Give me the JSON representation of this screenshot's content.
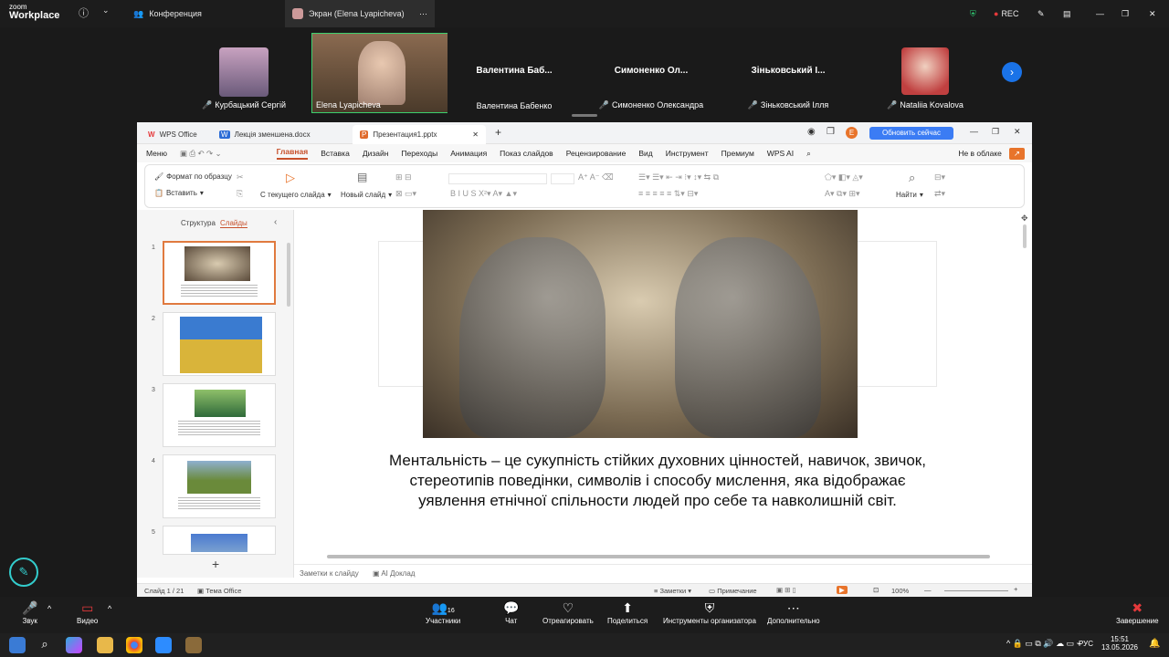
{
  "zoom": {
    "logo_small": "zoom",
    "logo_big": "Workplace",
    "tab_conference": "Конференция",
    "tab_screen": "Экран (Elena Lyapicheva)",
    "rec": "REC"
  },
  "participants": [
    {
      "name": "Курбацький Сергій",
      "big": ""
    },
    {
      "name": "Elena Lyapicheva",
      "big": ""
    },
    {
      "name": "Валентина Бабенко",
      "big": "Валентина  Баб..."
    },
    {
      "name": "Симоненко Олександра",
      "big": "Симоненко  Ол..."
    },
    {
      "name": "Зіньковський Ілля",
      "big": "Зіньковський І..."
    },
    {
      "name": "Nataliia Kovalova",
      "big": ""
    }
  ],
  "wps": {
    "tabs": [
      "WPS Office",
      "Лекція зменшена.docx",
      "Презентация1.pptx"
    ],
    "update_btn": "Обновить сейчас",
    "avatar_letter": "E",
    "menu": [
      "Меню",
      "Главная",
      "Вставка",
      "Дизайн",
      "Переходы",
      "Анимация",
      "Показ слайдов",
      "Рецензирование",
      "Вид",
      "Инструмент",
      "Премиум",
      "WPS AI"
    ],
    "cloud": "Не в облаке",
    "ribbon": {
      "format_painter": "Формат по образцу",
      "paste": "Вставить",
      "from_current": "С текущего слайда",
      "new_slide": "Новый слайд",
      "find": "Найти"
    },
    "panel_tabs": [
      "Структура",
      "Слайды"
    ],
    "slide_text": "Ментальність – це сукупність стійких духовних цінностей, навичок, звичок, стереотипів поведінки, символів і способу мислення, яка відображає уявлення етнічної спільности людей про себе та навколишній світ.",
    "notes": "Заметки к слайду",
    "ai_report": "AI Доклад",
    "status_slide": "Слайд 1 / 21",
    "status_theme": "Тема Office",
    "status_notes": "Заметки",
    "status_comment": "Примечание",
    "zoom_level": "100%"
  },
  "bottom": {
    "audio": "Звук",
    "video": "Видео",
    "participants": "Участники",
    "participants_count": "16",
    "chat": "Чат",
    "react": "Отреагировать",
    "share": "Поделиться",
    "host_tools": "Инструменты организатора",
    "more": "Дополнительно",
    "end": "Завершение"
  },
  "taskbar": {
    "lang": "РУС",
    "time": "15:51",
    "date": "13.05.2026"
  }
}
